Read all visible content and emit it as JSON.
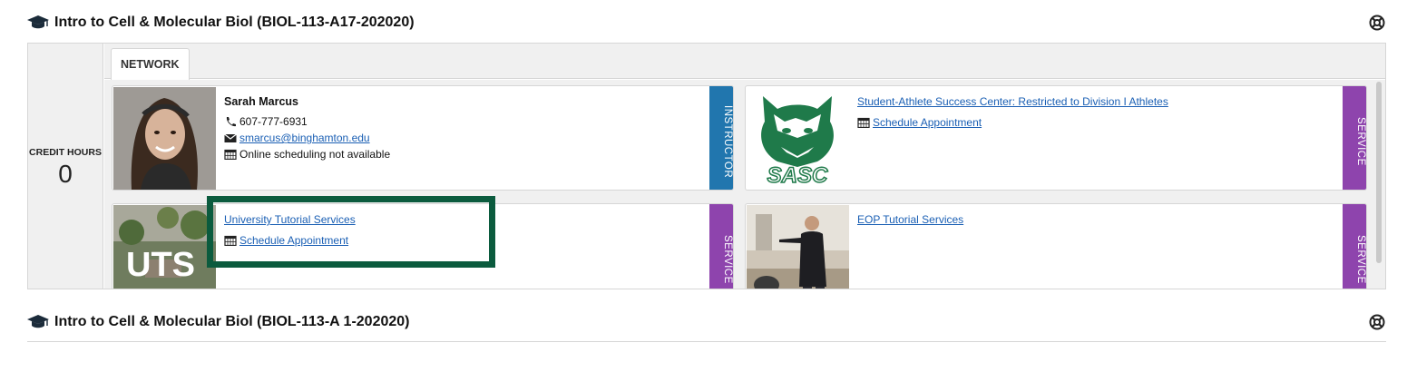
{
  "courses": [
    {
      "title": "Intro to Cell & Molecular Biol (BIOL-113-A17-202020)"
    },
    {
      "title": "Intro to Cell & Molecular Biol (BIOL-113-A 1-202020)"
    }
  ],
  "credit": {
    "label": "CREDIT HOURS",
    "value": "0"
  },
  "tabs": [
    {
      "label": "NETWORK"
    }
  ],
  "cards": {
    "marcus": {
      "name": "Sarah Marcus",
      "phone": "607-777-6931",
      "email": "smarcus@binghamton.edu",
      "scheduling": "Online scheduling not available",
      "side_label": "INSTRUCTOR"
    },
    "sasc": {
      "link": "Student-Athlete Success Center: Restricted to Division I Athletes",
      "schedule": "Schedule Appointment",
      "side_label": "SERVICE",
      "logo_text": "SASC"
    },
    "uts": {
      "link": "University Tutorial Services",
      "schedule": "Schedule Appointment",
      "side_label": "SERVICE",
      "logo_text": "UTS"
    },
    "eop": {
      "link": "EOP Tutorial Services",
      "side_label": "SERVICE"
    }
  },
  "icons": {
    "course": "graduation-cap-icon",
    "help": "lifebuoy-icon",
    "phone": "phone-icon",
    "email": "envelope-icon",
    "calendar": "calendar-icon"
  },
  "colors": {
    "instructor": "#2176ae",
    "service": "#8e44ad",
    "link": "#1a5fb4",
    "highlight": "#0b5b3e",
    "sasc_green": "#1f7a4a"
  }
}
